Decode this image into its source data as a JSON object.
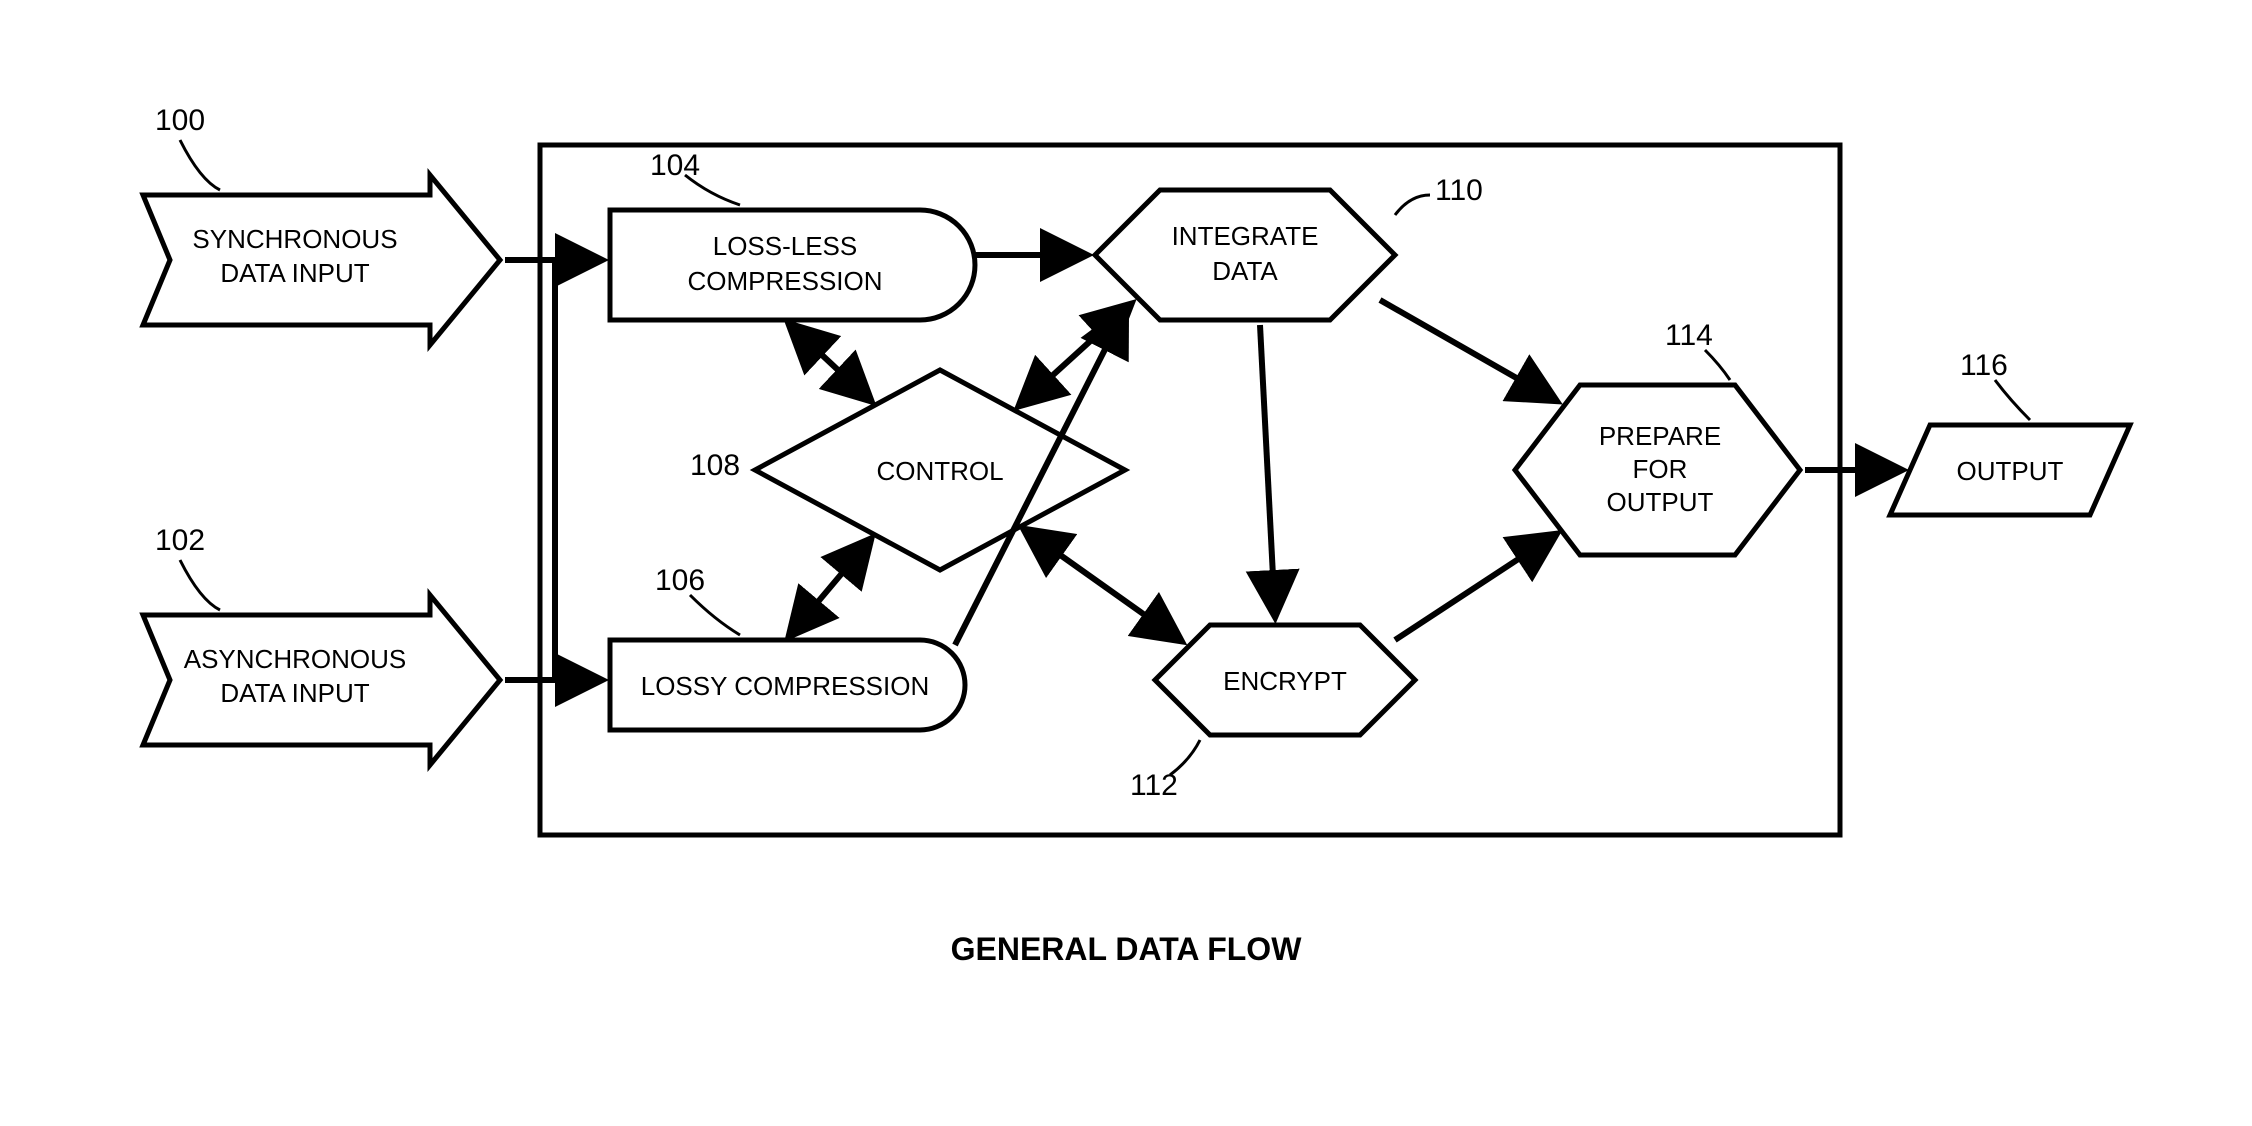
{
  "title": "GENERAL DATA FLOW",
  "refs": {
    "sync": "100",
    "async": "102",
    "lossless": "104",
    "lossy": "106",
    "control": "108",
    "integrate": "110",
    "encrypt": "112",
    "prepare": "114",
    "output": "116"
  },
  "nodes": {
    "sync1": "SYNCHRONOUS",
    "sync2": "DATA INPUT",
    "async1": "ASYNCHRONOUS",
    "async2": "DATA INPUT",
    "lossless1": "LOSS-LESS",
    "lossless2": "COMPRESSION",
    "lossy": "LOSSY COMPRESSION",
    "control": "CONTROL",
    "integrate1": "INTEGRATE",
    "integrate2": "DATA",
    "encrypt": "ENCRYPT",
    "prepare1": "PREPARE",
    "prepare2": "FOR",
    "prepare3": "OUTPUT",
    "output": "OUTPUT"
  }
}
